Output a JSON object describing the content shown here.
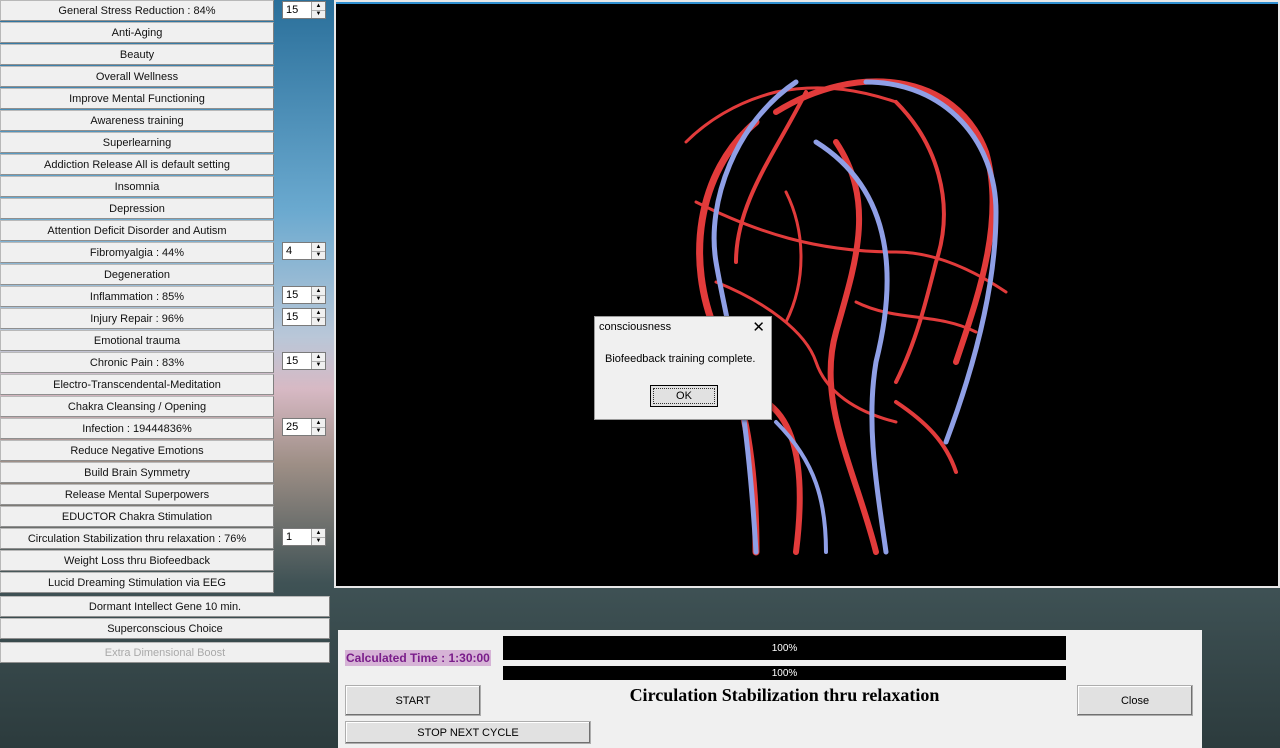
{
  "programs": [
    {
      "label": "General Stress Reduction  :  84%",
      "spinner": "15"
    },
    {
      "label": "Anti-Aging"
    },
    {
      "label": "Beauty"
    },
    {
      "label": "Overall Wellness"
    },
    {
      "label": "Improve Mental Functioning"
    },
    {
      "label": "Awareness training"
    },
    {
      "label": "Superlearning"
    },
    {
      "label": "Addiction  Release All is default setting"
    },
    {
      "label": "Insomnia"
    },
    {
      "label": "Depression"
    },
    {
      "label": "Attention Deficit Disorder and Autism"
    },
    {
      "label": "Fibromyalgia   :  44%",
      "spinner": "4"
    },
    {
      "label": "Degeneration"
    },
    {
      "label": "Inflammation  :  85%",
      "spinner": "15"
    },
    {
      "label": "Injury Repair  :  96%",
      "spinner": "15"
    },
    {
      "label": "Emotional trauma"
    },
    {
      "label": "Chronic Pain  :  83%",
      "spinner": "15"
    },
    {
      "label": "Electro-Transcendental-Meditation"
    },
    {
      "label": "Chakra Cleansing / Opening"
    },
    {
      "label": "Infection  :  19444836%",
      "spinner": "25"
    },
    {
      "label": "Reduce Negative Emotions"
    },
    {
      "label": "Build Brain Symmetry"
    },
    {
      "label": "Release Mental Superpowers"
    },
    {
      "label": "EDUCTOR Chakra Stimulation"
    },
    {
      "label": "Circulation Stabilization thru relaxation  :  76%",
      "spinner": "1"
    },
    {
      "label": "Weight Loss thru Biofeedback"
    },
    {
      "label": "Lucid Dreaming Stimulation via EEG"
    }
  ],
  "extra_programs": [
    {
      "label": "Dormant Intellect Gene 10 min."
    },
    {
      "label": "Superconscious Choice"
    },
    {
      "label": "Extra Dimensional Boost",
      "disabled": true
    }
  ],
  "dialog": {
    "title": "consciousness",
    "message": "Biofeedback training complete.",
    "ok_label": "OK",
    "close_glyph": "✕"
  },
  "controls": {
    "calculated_time": "Calculated Time : 1:30:00",
    "progress_1": "100%",
    "progress_2": "100%",
    "progress_1_value": 1.0,
    "progress_2_value": 1.0,
    "start_label": "START",
    "stop_label": "STOP NEXT CYCLE",
    "close_label": "Close",
    "session_title": "Circulation Stabilization thru relaxation"
  },
  "colors": {
    "artery": "#e23b3b",
    "vein": "#8f9fe6",
    "calc_time_text": "#7a1d8a",
    "calc_time_bg": "#d6b3d6"
  },
  "icons": {
    "spinner_up": "▲",
    "spinner_down": "▼"
  }
}
